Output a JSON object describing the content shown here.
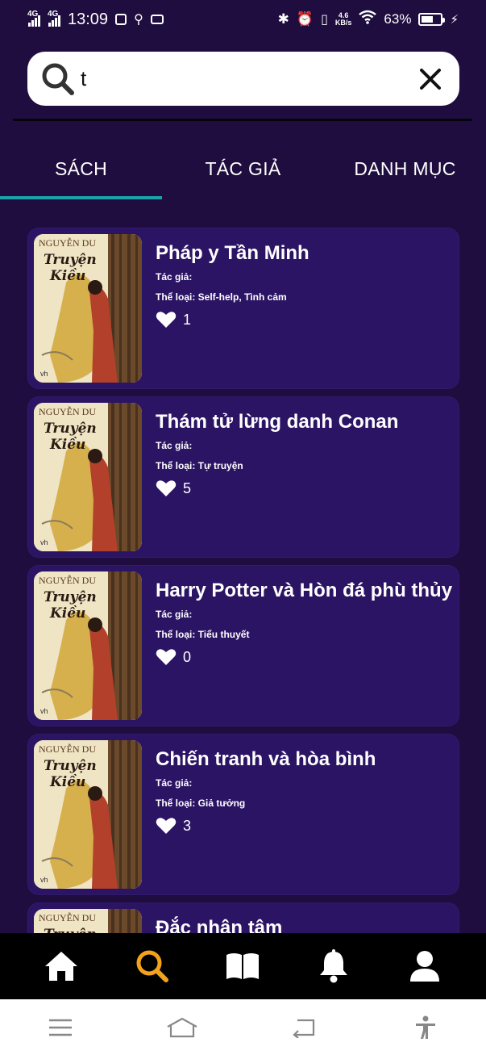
{
  "status_bar": {
    "time": "13:09",
    "network1": "4G",
    "network2": "4G",
    "speed_value": "4.6",
    "speed_unit": "KB/s",
    "battery": "63%",
    "battery_level": 0.63
  },
  "search": {
    "value": "t",
    "placeholder": ""
  },
  "tabs": [
    {
      "label": "SÁCH",
      "active": true
    },
    {
      "label": "TÁC GIẢ",
      "active": false
    },
    {
      "label": "DANH MỤC",
      "active": false
    }
  ],
  "books": [
    {
      "title": "Pháp y Tần Minh",
      "author_label": "Tác giả:",
      "genre_label": "Thể loại: Self-help, Tình cảm",
      "likes": "1"
    },
    {
      "title": "Thám tử lừng danh Conan",
      "author_label": "Tác giả:",
      "genre_label": "Thể loại: Tự truyện",
      "likes": "5"
    },
    {
      "title": "Harry Potter và Hòn đá phù thủy",
      "author_label": "Tác giả:",
      "genre_label": "Thể loại: Tiểu thuyết",
      "likes": "0"
    },
    {
      "title": "Chiến tranh và hòa bình",
      "author_label": "Tác giả:",
      "genre_label": "Thể loại: Giả tưởng",
      "likes": "3"
    },
    {
      "title": "Đắc nhân tâm",
      "author_label": "",
      "genre_label": "",
      "likes": ""
    }
  ],
  "cover": {
    "author_text": "NGUYỄN DU",
    "title_line1": "Truyện",
    "title_line2": "Kiều",
    "publisher": "vh"
  },
  "bottom_nav": [
    {
      "icon": "home-icon",
      "active": false
    },
    {
      "icon": "search-icon",
      "active": true
    },
    {
      "icon": "book-icon",
      "active": false
    },
    {
      "icon": "bell-icon",
      "active": false
    },
    {
      "icon": "profile-icon",
      "active": false
    }
  ],
  "colors": {
    "background": "#1e0d3e",
    "card": "#2b1464",
    "tab_indicator": "#1aa3a8",
    "active_nav": "#f2a31b"
  }
}
